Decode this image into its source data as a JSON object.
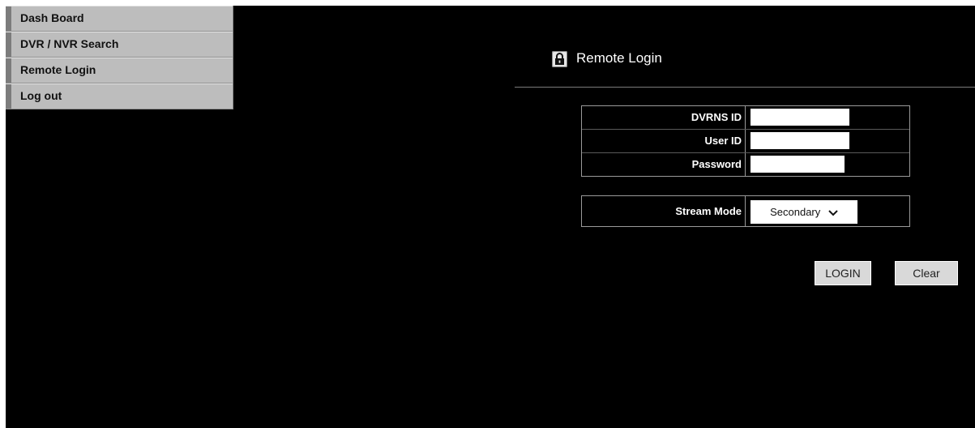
{
  "menu": {
    "items": [
      {
        "label": "Dash Board"
      },
      {
        "label": "DVR / NVR Search"
      },
      {
        "label": "Remote Login"
      },
      {
        "label": "Log out"
      }
    ]
  },
  "header": {
    "title": "Remote Login",
    "icon": "lock-icon"
  },
  "login_form": {
    "dvrns_id": {
      "label": "DVRNS ID",
      "value": ""
    },
    "user_id": {
      "label": "User ID",
      "value": ""
    },
    "password": {
      "label": "Password",
      "value": ""
    }
  },
  "stream_form": {
    "label": "Stream Mode",
    "selected": "Secondary",
    "icon": "chevron-down-icon"
  },
  "buttons": {
    "login": "LOGIN",
    "clear": "Clear"
  },
  "colors": {
    "background": "#000000",
    "menu": "#bdbdbd",
    "text": "#ffffff"
  }
}
